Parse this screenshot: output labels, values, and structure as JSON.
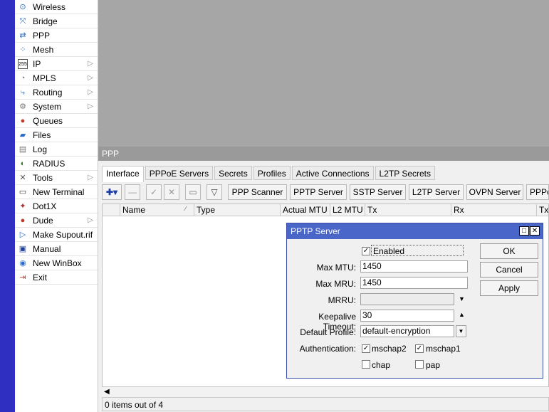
{
  "menu": [
    {
      "label": "Wireless",
      "icon": "wireless-icon",
      "glyph": "⊙",
      "submenu": false
    },
    {
      "label": "Bridge",
      "icon": "bridge-icon",
      "glyph": "⤧",
      "submenu": false
    },
    {
      "label": "PPP",
      "icon": "ppp-icon",
      "glyph": "⇄",
      "submenu": false
    },
    {
      "label": "Mesh",
      "icon": "mesh-icon",
      "glyph": "⁘",
      "submenu": false
    },
    {
      "label": "IP",
      "icon": "ip-icon",
      "glyph": "255",
      "submenu": true
    },
    {
      "label": "MPLS",
      "icon": "mpls-icon",
      "glyph": "◔",
      "submenu": true
    },
    {
      "label": "Routing",
      "icon": "routing-icon",
      "glyph": "⤷",
      "submenu": true
    },
    {
      "label": "System",
      "icon": "system-icon",
      "glyph": "⚙",
      "submenu": true
    },
    {
      "label": "Queues",
      "icon": "queues-icon",
      "glyph": "●",
      "submenu": false
    },
    {
      "label": "Files",
      "icon": "files-icon",
      "glyph": "▰",
      "submenu": false
    },
    {
      "label": "Log",
      "icon": "log-icon",
      "glyph": "▤",
      "submenu": false
    },
    {
      "label": "RADIUS",
      "icon": "radius-icon",
      "glyph": "◐",
      "submenu": false
    },
    {
      "label": "Tools",
      "icon": "tools-icon",
      "glyph": "✕",
      "submenu": true
    },
    {
      "label": "New Terminal",
      "icon": "terminal-icon",
      "glyph": "▭",
      "submenu": false
    },
    {
      "label": "Dot1X",
      "icon": "dot1x-icon",
      "glyph": "✦",
      "submenu": false
    },
    {
      "label": "Dude",
      "icon": "dude-icon",
      "glyph": "●",
      "submenu": true
    },
    {
      "label": "Make Supout.rif",
      "icon": "supout-icon",
      "glyph": "▷",
      "submenu": false
    },
    {
      "label": "Manual",
      "icon": "manual-icon",
      "glyph": "▣",
      "submenu": false
    },
    {
      "label": "New WinBox",
      "icon": "winbox-icon",
      "glyph": "◉",
      "submenu": false
    },
    {
      "label": "Exit",
      "icon": "exit-icon",
      "glyph": "⇥",
      "submenu": false
    }
  ],
  "ppp_window": {
    "title": "PPP",
    "tabs": [
      "Interface",
      "PPPoE Servers",
      "Secrets",
      "Profiles",
      "Active Connections",
      "L2TP Secrets"
    ],
    "toolbar_buttons": [
      "PPP Scanner",
      "PPTP Server",
      "SSTP Server",
      "L2TP Server",
      "OVPN Server",
      "PPPoE Scan"
    ],
    "columns": [
      "Name",
      "Type",
      "Actual MTU",
      "L2 MTU",
      "Tx",
      "Rx",
      "Tx P"
    ],
    "status": "0 items out of 4"
  },
  "dialog": {
    "title": "PPTP Server",
    "enabled_label": "Enabled",
    "enabled": true,
    "max_mtu_label": "Max MTU:",
    "max_mtu": "1450",
    "max_mru_label": "Max MRU:",
    "max_mru": "1450",
    "mrru_label": "MRRU:",
    "mrru": "",
    "keepalive_label": "Keepalive Timeout:",
    "keepalive": "30",
    "profile_label": "Default Profile:",
    "profile": "default-encryption",
    "auth_label": "Authentication:",
    "auth": [
      {
        "label": "mschap2",
        "checked": true
      },
      {
        "label": "mschap1",
        "checked": true
      },
      {
        "label": "chap",
        "checked": false
      },
      {
        "label": "pap",
        "checked": false
      }
    ],
    "buttons": {
      "ok": "OK",
      "cancel": "Cancel",
      "apply": "Apply"
    }
  }
}
